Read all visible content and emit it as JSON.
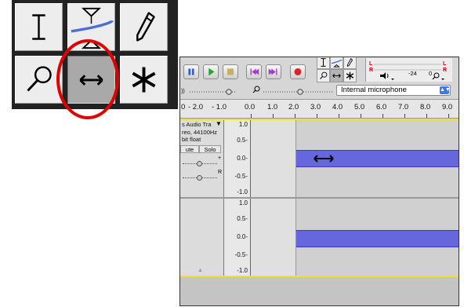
{
  "callout": {
    "tools": [
      {
        "id": "selection",
        "icon": "i-beam-selection-icon",
        "pressed": false
      },
      {
        "id": "envelope",
        "icon": "envelope-tool-icon",
        "pressed": false
      },
      {
        "id": "draw",
        "icon": "pencil-draw-icon",
        "pressed": false
      },
      {
        "id": "zoom",
        "icon": "magnifier-zoom-icon",
        "pressed": false
      },
      {
        "id": "time-shift",
        "icon": "time-shift-arrow-icon",
        "pressed": true
      },
      {
        "id": "multi",
        "icon": "multi-tool-asterisk-icon",
        "pressed": false
      }
    ],
    "ring_color": "#e00000"
  },
  "transport": [
    "pause-icon",
    "play-icon",
    "stop-icon",
    "skip-start-icon",
    "skip-end-icon",
    "record-icon"
  ],
  "meter": {
    "left_label": "L",
    "right_label": "R",
    "value": "-24",
    "zero": "0"
  },
  "device": {
    "label": "Internal microphone"
  },
  "ruler": {
    "labels": [
      "0",
      "- 2.0",
      "- 1.0",
      "0.0",
      "1.0",
      "2.0",
      "3.0",
      "4.0",
      "5.0",
      "6.0",
      "7.0",
      "8.0",
      "9.0"
    ]
  },
  "track": {
    "name": "s Audio Tra",
    "rate": "reo, 44100Hz",
    "format": "bit float",
    "mute": "ute",
    "solo": "Solo",
    "gain_plus": "+",
    "pan_r": "R",
    "scale_top": [
      "1.0",
      "0.5-",
      "0.0-",
      "-0.5-",
      "-1.0"
    ],
    "scale_bottom": [
      "1.0",
      "0.5-",
      "0.0-",
      "-0.5-",
      "-1.0"
    ]
  },
  "colors": {
    "waveform": "#6666dd",
    "record": "#dd2222",
    "play": "#22aa22",
    "accent": "#3d7be0"
  }
}
